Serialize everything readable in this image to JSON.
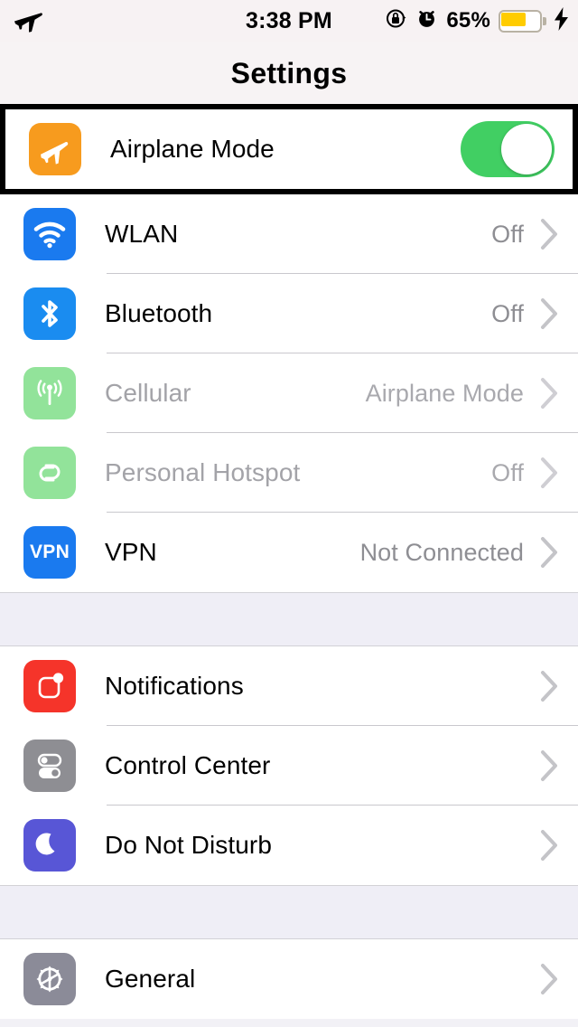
{
  "status_bar": {
    "airplane_icon": "airplane-icon",
    "time": "3:38 PM",
    "rotation_lock_icon": "rotation-lock-icon",
    "alarm_icon": "alarm-clock-icon",
    "battery_percent": "65%",
    "battery_level": 65,
    "battery_color": "#ffcc00",
    "charging_icon": "lightning-bolt-icon"
  },
  "navbar": {
    "title": "Settings"
  },
  "sections": [
    {
      "rows": [
        {
          "name": "airplane-mode",
          "label": "Airplane Mode",
          "icon": "airplane-icon",
          "icon_color": "#f79b1e",
          "control": "toggle",
          "toggle_on": true,
          "toggle_color": "#41cf63",
          "highlighted": true,
          "disabled": false
        },
        {
          "name": "wlan",
          "label": "WLAN",
          "value": "Off",
          "icon": "wifi-icon",
          "icon_color": "#1a7aef",
          "control": "chevron",
          "disabled": false
        },
        {
          "name": "bluetooth",
          "label": "Bluetooth",
          "value": "Off",
          "icon": "bluetooth-icon",
          "icon_color": "#1a8cf0",
          "control": "chevron",
          "disabled": false
        },
        {
          "name": "cellular",
          "label": "Cellular",
          "value": "Airplane Mode",
          "icon": "cellular-antenna-icon",
          "icon_color": "#92e39a",
          "control": "chevron",
          "disabled": true
        },
        {
          "name": "personal-hotspot",
          "label": "Personal Hotspot",
          "value": "Off",
          "icon": "hotspot-link-icon",
          "icon_color": "#92e39a",
          "control": "chevron",
          "disabled": true
        },
        {
          "name": "vpn",
          "label": "VPN",
          "value": "Not Connected",
          "icon": "vpn-icon",
          "icon_color": "#1a7aef",
          "icon_text": "VPN",
          "control": "chevron",
          "disabled": false
        }
      ]
    },
    {
      "rows": [
        {
          "name": "notifications",
          "label": "Notifications",
          "icon": "notifications-badge-icon",
          "icon_color": "#f5342a",
          "control": "chevron",
          "disabled": false
        },
        {
          "name": "control-center",
          "label": "Control Center",
          "icon": "control-center-toggles-icon",
          "icon_color": "#8e8e93",
          "control": "chevron",
          "disabled": false
        },
        {
          "name": "do-not-disturb",
          "label": "Do Not Disturb",
          "icon": "moon-icon",
          "icon_color": "#5856d6",
          "control": "chevron",
          "disabled": false
        }
      ]
    },
    {
      "rows": [
        {
          "name": "general",
          "label": "General",
          "icon": "gear-icon",
          "icon_color": "#8e8e93",
          "control": "chevron",
          "disabled": false
        }
      ]
    }
  ]
}
